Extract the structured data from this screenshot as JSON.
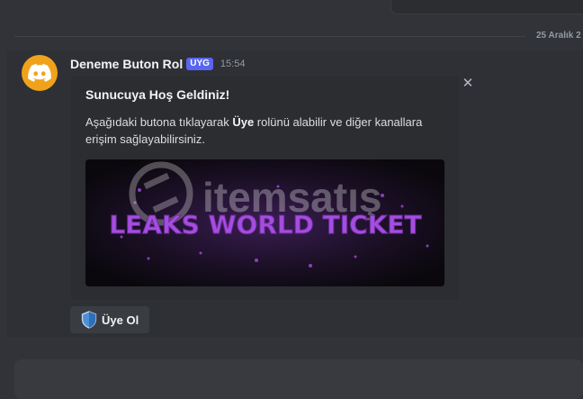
{
  "divider": {
    "date": "25 Aralık 2"
  },
  "message": {
    "username": "Deneme Buton Rol",
    "app_tag": "UYG",
    "timestamp": "15:54",
    "avatar_icon": "discord-logo-icon",
    "avatar_color": "#f0a31a"
  },
  "embed": {
    "title": "Sunucuya Hoş Geldiniz!",
    "description_before": "Aşağıdaki butona tıklayarak ",
    "description_bold": "Üye",
    "description_after": " rolünü alabilir ve diğer kanallara erişim sağlayabilirsiniz.",
    "close_glyph": "✕",
    "image": {
      "banner_text": "LEAKS WORLD TICKET",
      "watermark_text": "itemsatış"
    }
  },
  "button": {
    "label": "Üye Ol",
    "icon": "shield-icon"
  },
  "colors": {
    "background": "#313338",
    "embed": "#2b2d31",
    "brand": "#5865f2",
    "banner_purple": "#a64de0"
  }
}
